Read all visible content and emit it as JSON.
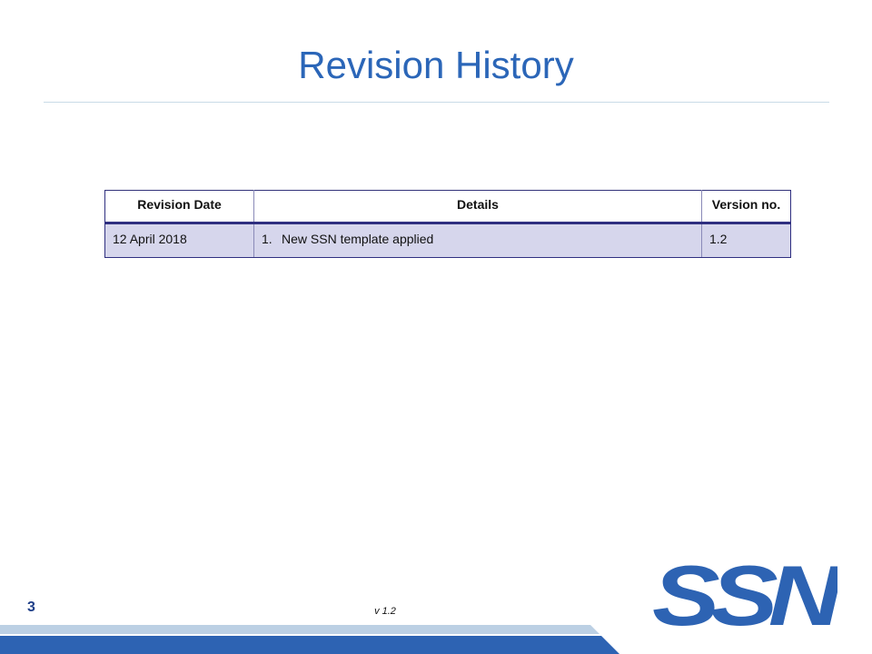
{
  "slide": {
    "title": "Revision History",
    "page_number": "3",
    "footer_version": "v 1.2",
    "logo_text": "SSN"
  },
  "table": {
    "headers": [
      "Revision Date",
      "Details",
      "Version no."
    ],
    "rows": [
      {
        "date": "12 April 2018",
        "details_number": "1.",
        "details": "New SSN template applied",
        "version": "1.2"
      }
    ]
  },
  "colors": {
    "title": "#2b66b8",
    "table_border": "#2f2f80",
    "row_fill": "#d6d6ec",
    "logo": "#2d63b3",
    "footer_band_light": "#bcd0e4",
    "footer_band_dark": "#2d63b3"
  }
}
